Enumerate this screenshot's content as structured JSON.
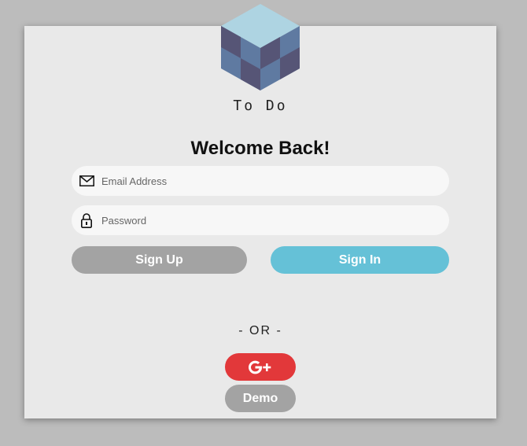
{
  "app": {
    "name": "To Do"
  },
  "header": {
    "title": "Welcome Back!"
  },
  "form": {
    "email_placeholder": "Email Address",
    "password_placeholder": "Password",
    "email_value": "",
    "password_value": ""
  },
  "buttons": {
    "signup_label": "Sign Up",
    "signin_label": "Sign In",
    "demo_label": "Demo"
  },
  "divider": {
    "text": "- OR -"
  },
  "icons": {
    "email": "envelope-icon",
    "password": "lock-icon",
    "google": "google-plus-icon",
    "logo": "cube-logo-icon"
  },
  "colors": {
    "background": "#bcbcbc",
    "card": "#e9e9e9",
    "signin": "#65c1d7",
    "signup": "#a3a3a3",
    "google": "#e2383a"
  }
}
